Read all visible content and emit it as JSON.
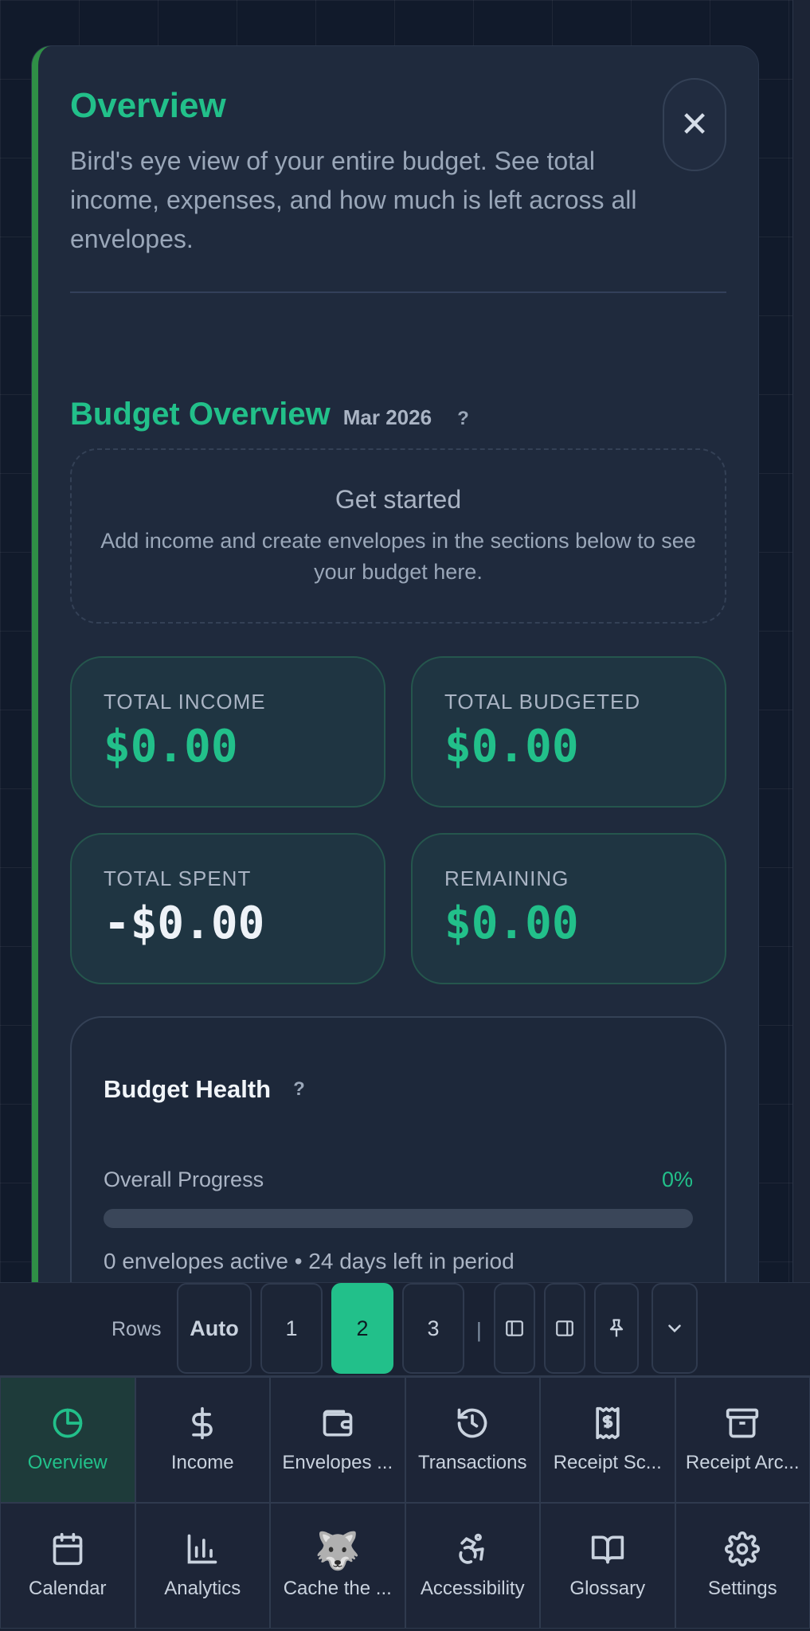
{
  "overview_panel": {
    "title": "Overview",
    "description": "Bird's eye view of your entire budget. See total income, expenses, and how much is left across all envelopes.",
    "close_label": "✕"
  },
  "budget_overview": {
    "title": "Budget Overview",
    "month": "Mar 2026",
    "help": "?",
    "get_started": {
      "title": "Get started",
      "text": "Add income and create envelopes in the sections below to see your budget here."
    },
    "stats": [
      {
        "label": "TOTAL INCOME",
        "value": "$0.00"
      },
      {
        "label": "TOTAL BUDGETED",
        "value": "$0.00"
      },
      {
        "label": "TOTAL SPENT",
        "value": "-$0.00"
      },
      {
        "label": "REMAINING",
        "value": "$0.00"
      }
    ],
    "health": {
      "title": "Budget Health",
      "help": "?",
      "progress_label": "Overall Progress",
      "progress_pct": "0%",
      "progress_value": 0,
      "footer": "0 envelopes active • 24 days left in period"
    }
  },
  "toolbar": {
    "rows_label": "Rows",
    "buttons": [
      "Auto",
      "1",
      "2",
      "3"
    ],
    "active": "2",
    "separator": "|"
  },
  "nav": {
    "items": [
      {
        "label": "Overview",
        "icon": "pie-chart-icon"
      },
      {
        "label": "Income",
        "icon": "dollar-icon"
      },
      {
        "label": "Envelopes ...",
        "icon": "wallet-icon"
      },
      {
        "label": "Transactions",
        "icon": "history-icon"
      },
      {
        "label": "Receipt Sc...",
        "icon": "receipt-icon"
      },
      {
        "label": "Receipt Arc...",
        "icon": "archive-icon"
      },
      {
        "label": "Calendar",
        "icon": "calendar-icon"
      },
      {
        "label": "Analytics",
        "icon": "bar-chart-icon"
      },
      {
        "label": "Cache the ...",
        "icon": "wolf-emoji",
        "emoji": "🐺"
      },
      {
        "label": "Accessibility",
        "icon": "accessibility-icon"
      },
      {
        "label": "Glossary",
        "icon": "book-icon"
      },
      {
        "label": "Settings",
        "icon": "gear-icon"
      }
    ]
  },
  "colors": {
    "accent": "#22c08a",
    "card_border": "#2f8f46",
    "background": "#111a2b"
  }
}
